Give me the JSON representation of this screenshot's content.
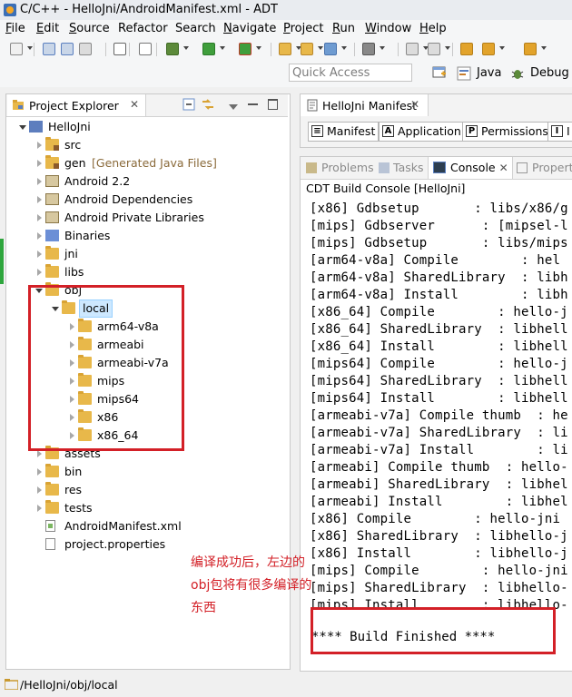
{
  "window": {
    "title": "C/C++ - HelloJni/AndroidManifest.xml - ADT"
  },
  "menubar": {
    "items": [
      {
        "label": "File",
        "u": "F",
        "rest": "ile"
      },
      {
        "label": "Edit",
        "u": "E",
        "rest": "dit"
      },
      {
        "label": "Source",
        "u": "S",
        "rest": "ource"
      },
      {
        "label": "Refactor",
        "u": "",
        "rest": "Refactor"
      },
      {
        "label": "Search",
        "u": "",
        "rest": "Search"
      },
      {
        "label": "Navigate",
        "u": "N",
        "rest": "avigate"
      },
      {
        "label": "Project",
        "u": "P",
        "rest": "roject"
      },
      {
        "label": "Run",
        "u": "R",
        "rest": "un"
      },
      {
        "label": "Window",
        "u": "W",
        "rest": "indow"
      },
      {
        "label": "Help",
        "u": "H",
        "rest": "elp"
      }
    ]
  },
  "quick_access": {
    "placeholder": "Quick Access"
  },
  "perspectives": {
    "java": "Java",
    "debug": "Debug"
  },
  "project_explorer": {
    "tab_label": "Project Explorer",
    "tree": [
      {
        "label": "HelloJni",
        "icon": "project-icon",
        "expanded": true,
        "depth": 0
      },
      {
        "label": "src",
        "icon": "package-folder-icon",
        "depth": 1
      },
      {
        "label": "gen",
        "suffix": "[Generated Java Files]",
        "icon": "package-folder-icon",
        "depth": 1
      },
      {
        "label": "Android 2.2",
        "icon": "library-icon",
        "depth": 1
      },
      {
        "label": "Android Dependencies",
        "icon": "library-icon",
        "depth": 1
      },
      {
        "label": "Android Private Libraries",
        "icon": "library-icon",
        "depth": 1
      },
      {
        "label": "Binaries",
        "icon": "binaries-icon",
        "depth": 1
      },
      {
        "label": "jni",
        "icon": "folder-icon",
        "depth": 1
      },
      {
        "label": "libs",
        "icon": "folder-icon",
        "depth": 1
      },
      {
        "label": "obj",
        "icon": "folder-icon",
        "expanded": true,
        "depth": 1
      },
      {
        "label": "local",
        "icon": "folder-icon",
        "expanded": true,
        "depth": 2,
        "selected": true
      },
      {
        "label": "arm64-v8a",
        "icon": "folder-icon",
        "depth": 3
      },
      {
        "label": "armeabi",
        "icon": "folder-icon",
        "depth": 3
      },
      {
        "label": "armeabi-v7a",
        "icon": "folder-icon",
        "depth": 3
      },
      {
        "label": "mips",
        "icon": "folder-icon",
        "depth": 3
      },
      {
        "label": "mips64",
        "icon": "folder-icon",
        "depth": 3
      },
      {
        "label": "x86",
        "icon": "folder-icon",
        "depth": 3
      },
      {
        "label": "x86_64",
        "icon": "folder-icon",
        "depth": 3
      },
      {
        "label": "assets",
        "icon": "folder-icon",
        "depth": 1
      },
      {
        "label": "bin",
        "icon": "folder-icon",
        "depth": 1
      },
      {
        "label": "res",
        "icon": "folder-icon",
        "depth": 1
      },
      {
        "label": "tests",
        "icon": "folder-icon",
        "depth": 1
      },
      {
        "label": "AndroidManifest.xml",
        "icon": "xml-file-icon",
        "depth": 1,
        "leaf": true
      },
      {
        "label": "project.properties",
        "icon": "file-icon",
        "depth": 1,
        "leaf": true
      }
    ]
  },
  "editor": {
    "tab_label": "HelloJni Manifest",
    "page_tabs": [
      {
        "label": "Manifest",
        "glyph": "≡"
      },
      {
        "label": "Application",
        "glyph": "A"
      },
      {
        "label": "Permissions",
        "glyph": "P"
      },
      {
        "label": "I",
        "glyph": "I"
      }
    ]
  },
  "console": {
    "tabs": [
      "Problems",
      "Tasks",
      "Console",
      "Properti"
    ],
    "active_tab": "Console",
    "title": "CDT Build Console [HelloJni]",
    "lines": [
      "[x86] Gdbsetup       : libs/x86/g",
      "[mips] Gdbserver      : [mipsel-l",
      "[mips] Gdbsetup       : libs/mips",
      "[arm64-v8a] Compile        : hel",
      "[arm64-v8a] SharedLibrary  : libh",
      "[arm64-v8a] Install        : libh",
      "[x86_64] Compile        : hello-j",
      "[x86_64] SharedLibrary  : libhell",
      "[x86_64] Install        : libhell",
      "[mips64] Compile        : hello-j",
      "[mips64] SharedLibrary  : libhell",
      "[mips64] Install        : libhell",
      "[armeabi-v7a] Compile thumb  : he",
      "[armeabi-v7a] SharedLibrary  : li",
      "[armeabi-v7a] Install        : li",
      "[armeabi] Compile thumb  : hello-",
      "[armeabi] SharedLibrary  : libhel",
      "[armeabi] Install        : libhel",
      "[x86] Compile        : hello-jni",
      "[x86] SharedLibrary  : libhello-j",
      "[x86] Install        : libhello-j",
      "[mips] Compile        : hello-jni",
      "[mips] SharedLibrary  : libhello-",
      "[mips] Install        : libhello-"
    ],
    "finished": "**** Build Finished ****"
  },
  "annotation": "编译成功后，左边的obj包将有很多编译的东西",
  "statusbar": {
    "path": "/HelloJni/obj/local"
  },
  "colors": {
    "highlight": "#d32027",
    "folder": "#e8b84a",
    "selection": "#cde8ff"
  }
}
